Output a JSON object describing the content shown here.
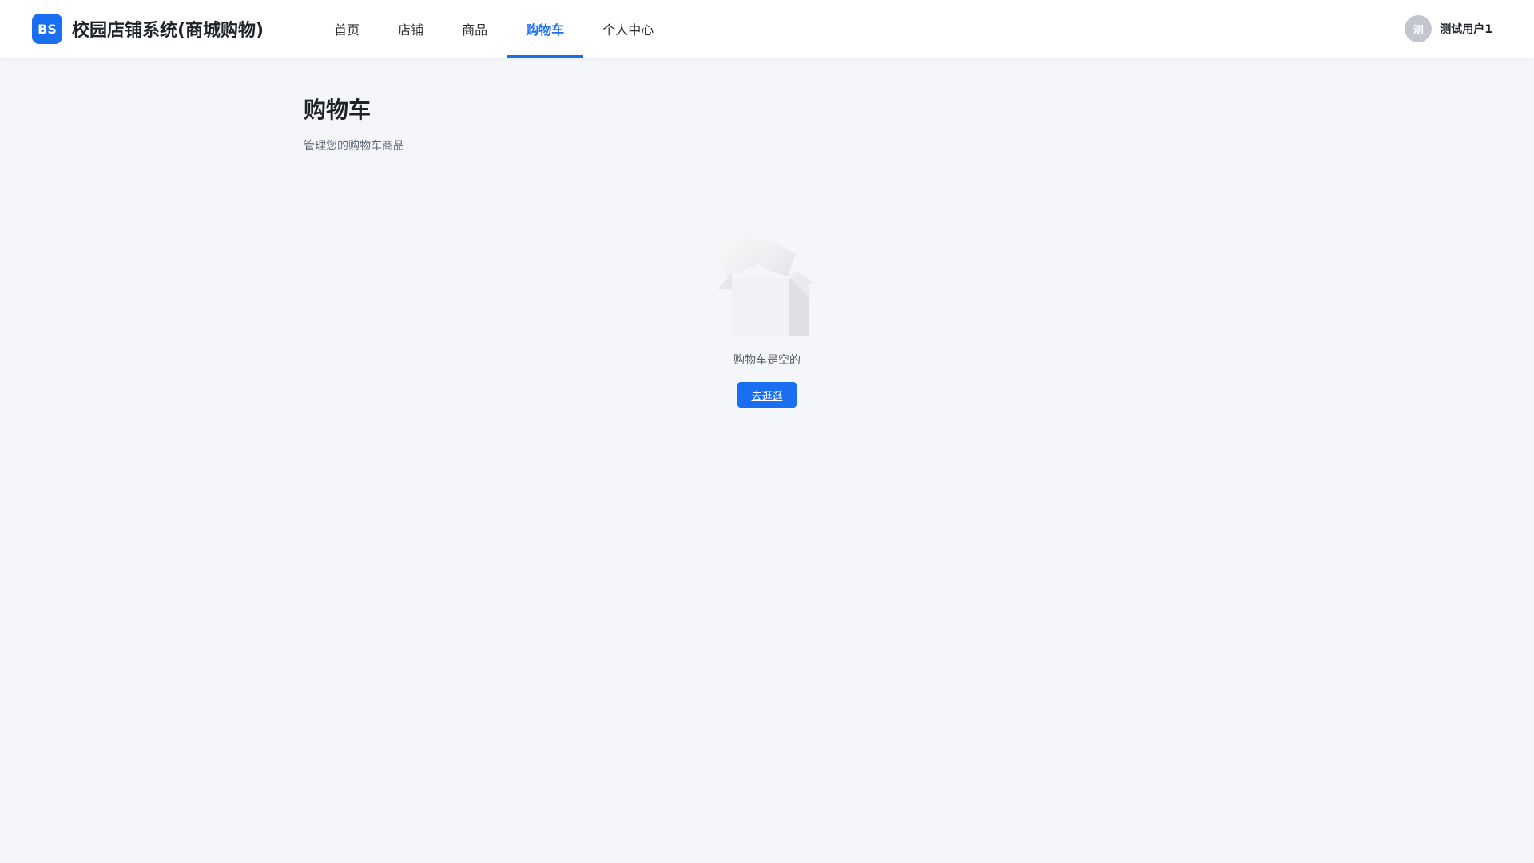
{
  "brand": {
    "logo_text": "BS",
    "title": "校园店铺系统(商城购物)"
  },
  "nav": {
    "items": [
      {
        "label": "首页"
      },
      {
        "label": "店铺"
      },
      {
        "label": "商品"
      },
      {
        "label": "购物车",
        "active": true
      },
      {
        "label": "个人中心"
      }
    ]
  },
  "user": {
    "avatar_text": "测",
    "name": "测试用户1"
  },
  "page": {
    "title": "购物车",
    "subtitle": "管理您的购物车商品"
  },
  "empty_state": {
    "icon": "empty-box-icon",
    "message": "购物车是空的",
    "button_label": "去逛逛"
  },
  "colors": {
    "accent": "#1a6ff0",
    "background": "#f5f6f9",
    "avatar": "#c3c6cc"
  }
}
